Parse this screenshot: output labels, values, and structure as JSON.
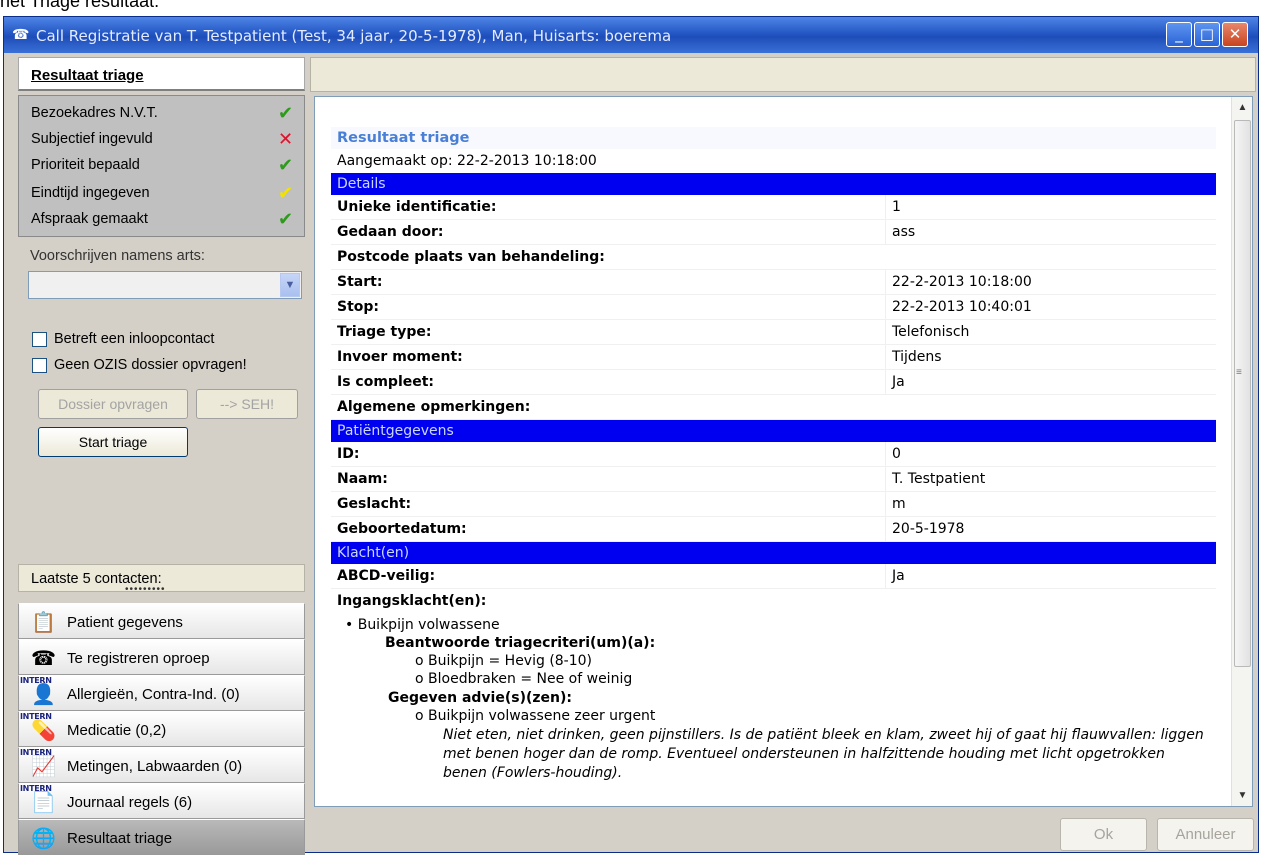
{
  "caption": "het Triage resultaat.",
  "window": {
    "title": "Call Registratie van T.  Testpatient (Test, 34 jaar, 20-5-1978), Man, Huisarts: boerema",
    "min": "_",
    "max": "□",
    "close": "✕"
  },
  "left": {
    "header": "Resultaat triage",
    "status": [
      {
        "label": "Bezoekadres N.V.T.",
        "mark": "✔",
        "color": "#2f9a1d"
      },
      {
        "label": "Subjectief ingevuld",
        "mark": "✕",
        "color": "#e0102a"
      },
      {
        "label": "Prioriteit bepaald",
        "mark": "✔",
        "color": "#2f9a1d"
      },
      {
        "label": "Eindtijd ingegeven",
        "mark": "✔",
        "color": "#f2e200"
      },
      {
        "label": "Afspraak gemaakt",
        "mark": "✔",
        "color": "#2f9a1d"
      }
    ],
    "prescribe_label": "Voorschrijven namens arts:",
    "combo_value": "",
    "check_walkin": "Betreft een inloopcontact",
    "check_ozis": "Geen OZIS dossier opvragen!",
    "btn_dossier": "Dossier opvragen",
    "btn_seh": "--> SEH!",
    "btn_start": "Start triage",
    "laatste": "Laatste 5 contacten:",
    "laatste_dots": "•••••••••",
    "intern": "INTERN",
    "nav": [
      {
        "label": "Patient gegevens",
        "icon": "📋"
      },
      {
        "label": "Te registreren oproep",
        "icon": "☎"
      },
      {
        "label": "Allergieën, Contra-Ind. (0)",
        "icon": "👤"
      },
      {
        "label": "Medicatie (0,2)",
        "icon": "💊"
      },
      {
        "label": "Metingen, Labwaarden (0)",
        "icon": "📈"
      },
      {
        "label": "Journaal regels (6)",
        "icon": "📄"
      },
      {
        "label": "Resultaat triage",
        "icon": "🌐"
      }
    ]
  },
  "doc": {
    "title": "Resultaat triage",
    "created": "Aangemaakt op: 22-2-2013 10:18:00",
    "sections": {
      "details": "Details",
      "patient": "Patiëntgegevens",
      "klacht": "Klacht(en)"
    },
    "details": [
      {
        "k": "Unieke identificatie:",
        "v": "1"
      },
      {
        "k": "Gedaan door:",
        "v": "ass"
      },
      {
        "k": "Postcode plaats van behandeling:",
        "v": ""
      },
      {
        "k": "Start:",
        "v": "22-2-2013 10:18:00"
      },
      {
        "k": "Stop:",
        "v": "22-2-2013 10:40:01"
      },
      {
        "k": "Triage type:",
        "v": "Telefonisch"
      },
      {
        "k": "Invoer moment:",
        "v": "Tijdens"
      },
      {
        "k": "Is compleet:",
        "v": "Ja"
      },
      {
        "k": "Algemene opmerkingen:",
        "v": ""
      }
    ],
    "patient": [
      {
        "k": "ID:",
        "v": "0"
      },
      {
        "k": "Naam:",
        "v": "T. Testpatient"
      },
      {
        "k": "Geslacht:",
        "v": "m"
      },
      {
        "k": "Geboortedatum:",
        "v": "20-5-1978"
      }
    ],
    "klacht": [
      {
        "k": "ABCD-veilig:",
        "v": "Ja"
      },
      {
        "k": "Ingangsklacht(en):",
        "v": ""
      }
    ],
    "complaint": {
      "item": "• Buikpijn volwassene",
      "criteria_title": "Beantwoorde triagecriteri(um)(a):",
      "crit1": "o Buikpijn = Hevig (8-10)",
      "crit2": "o Bloedbraken = Nee of weinig",
      "advice_title": "Gegeven advie(s)(zen):",
      "advice1": "o Buikpijn volwassene zeer urgent",
      "advice_text": "Niet eten, niet drinken, geen pijnstillers. Is de patiënt bleek en klam, zweet hij of gaat hij flauwvallen: liggen met benen hoger dan de romp. Eventueel ondersteunen in halfzittende houding met licht opgetrokken benen (Fowlers-houding)."
    }
  },
  "footer": {
    "ok": "Ok",
    "cancel": "Annuleer"
  }
}
